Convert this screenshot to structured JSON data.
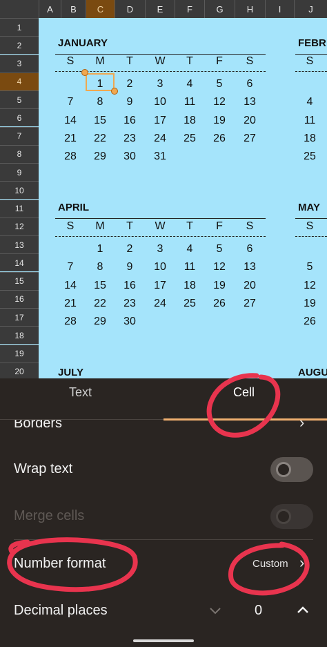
{
  "columns": [
    "A",
    "B",
    "C",
    "D",
    "E",
    "F",
    "G",
    "H",
    "I",
    "J"
  ],
  "rows": [
    "1",
    "2",
    "3",
    "4",
    "5",
    "6",
    "7",
    "8",
    "9",
    "10",
    "11",
    "12",
    "13",
    "14",
    "15",
    "16",
    "17",
    "18",
    "19",
    "20"
  ],
  "weekdays": [
    "S",
    "M",
    "T",
    "W",
    "T",
    "F",
    "S"
  ],
  "calendar": {
    "jan": {
      "name": "JANUARY",
      "weeks": [
        [
          "",
          "1",
          "2",
          "3",
          "4",
          "5",
          "6"
        ],
        [
          "7",
          "8",
          "9",
          "10",
          "11",
          "12",
          "13"
        ],
        [
          "14",
          "15",
          "16",
          "17",
          "18",
          "19",
          "20"
        ],
        [
          "21",
          "22",
          "23",
          "24",
          "25",
          "26",
          "27"
        ],
        [
          "28",
          "29",
          "30",
          "31",
          "",
          "",
          ""
        ]
      ]
    },
    "apr": {
      "name": "APRIL",
      "weeks": [
        [
          "",
          "1",
          "2",
          "3",
          "4",
          "5",
          "6"
        ],
        [
          "7",
          "8",
          "9",
          "10",
          "11",
          "12",
          "13"
        ],
        [
          "14",
          "15",
          "16",
          "17",
          "18",
          "19",
          "20"
        ],
        [
          "21",
          "22",
          "23",
          "24",
          "25",
          "26",
          "27"
        ],
        [
          "28",
          "29",
          "30",
          "",
          "",
          "",
          ""
        ]
      ]
    },
    "jul": {
      "name": "JULY"
    },
    "feb": {
      "name": "FEBR",
      "header": "S",
      "col": [
        "",
        "4",
        "11",
        "18",
        "25"
      ]
    },
    "may": {
      "name": "MAY",
      "header": "S",
      "col": [
        "",
        "5",
        "12",
        "19",
        "26"
      ]
    },
    "aug": {
      "name": "AUGU"
    }
  },
  "panel": {
    "tabs": {
      "text": "Text",
      "cell": "Cell"
    },
    "borders": "Borders",
    "wrap_text": "Wrap text",
    "merge_cells": "Merge cells",
    "number_format": "Number format",
    "number_format_value": "Custom",
    "decimal_places": "Decimal places",
    "decimal_value": "0"
  },
  "colors": {
    "sheet_bg": "#a5e4fb",
    "accent": "#f0b070",
    "annotation": "#e8344e"
  }
}
